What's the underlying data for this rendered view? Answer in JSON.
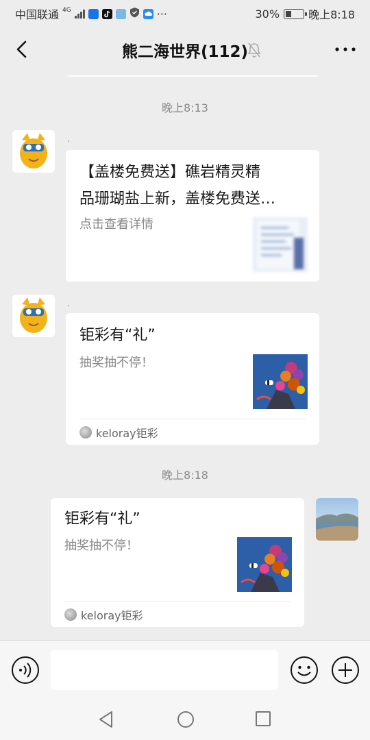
{
  "status_bar": {
    "carrier": "中国联通",
    "network": "4G",
    "battery_percent": "30%",
    "battery_level": 0.3,
    "time": "晚上8:18",
    "more": "···",
    "icons": [
      "signal-icon",
      "app-icon",
      "tiktok-icon",
      "app-icon",
      "shield-icon",
      "cloud-icon"
    ]
  },
  "header": {
    "title": "熊二海世界(112)",
    "icons": [
      "back-icon",
      "mute-icon",
      "more-icon"
    ]
  },
  "messages": [
    {
      "type": "time",
      "text": "晚上8:13"
    },
    {
      "type": "link_card",
      "side": "left",
      "sender": ".",
      "title_line1": "【盖楼免费送】礁岩精灵精",
      "title_line2": "品珊瑚盐上新，盖楼免费送…",
      "desc": "点击查看详情"
    },
    {
      "type": "mini_card",
      "side": "left",
      "sender": ".",
      "title": "钜彩有“礼”",
      "desc": "抽奖抽不停！",
      "source": "keloray钜彩"
    },
    {
      "type": "time",
      "text": "晚上8:18"
    },
    {
      "type": "mini_card",
      "side": "right",
      "title": "钜彩有“礼”",
      "desc": "抽奖抽不停！",
      "source": "keloray钜彩"
    }
  ],
  "input_bar": {
    "placeholder": "",
    "icons": [
      "voice-icon",
      "emoji-icon",
      "plus-icon"
    ]
  },
  "nav_bar": {
    "icons": [
      "nav-back-icon",
      "nav-home-icon",
      "nav-recent-icon"
    ]
  },
  "colors": {
    "background": "#ededed",
    "bubble": "#ffffff",
    "time_text": "#8a8a8a"
  }
}
